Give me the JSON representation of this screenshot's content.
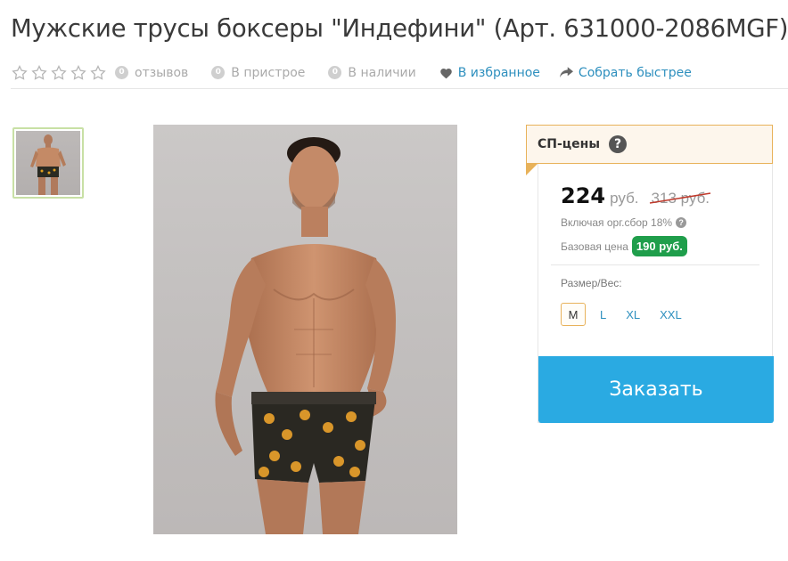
{
  "product": {
    "title": "Мужские трусы боксеры \"Индефини\" (Арт. 631000-2086MGF)"
  },
  "meta": {
    "rating_stars": 5,
    "rating_value": 0,
    "reviews_count": "0",
    "reviews_label": "отзывов",
    "pristroy_count": "0",
    "pristroy_label": "В пристрое",
    "stock_count": "0",
    "stock_label": "В наличии",
    "favorites_label": "В избранное",
    "collect_label": "Собрать быстрее"
  },
  "price_panel": {
    "header": "СП-цены",
    "help": "?",
    "price": "224",
    "currency": "руб.",
    "old_price": "313 руб.",
    "fee_note": "Включая орг.сбор 18%",
    "fee_help": "?",
    "base_label": "Базовая цена",
    "base_price": "190 руб.",
    "size_label": "Размер/Вес:",
    "sizes": [
      "M",
      "L",
      "XL",
      "XXL"
    ],
    "selected_size": "M",
    "order_button": "Заказать"
  },
  "colors": {
    "accent_blue": "#2aaae2",
    "link_blue": "#2d8fbe",
    "badge_green": "#1f9e4b",
    "header_border": "#e8b25a",
    "thumb_border": "#c8e0a5",
    "strike_red": "#c0392b"
  },
  "icons": {
    "rating": "star-outline-icon",
    "favorites": "heart-icon",
    "collect": "share-arrow-icon",
    "help": "question-circle-icon"
  }
}
